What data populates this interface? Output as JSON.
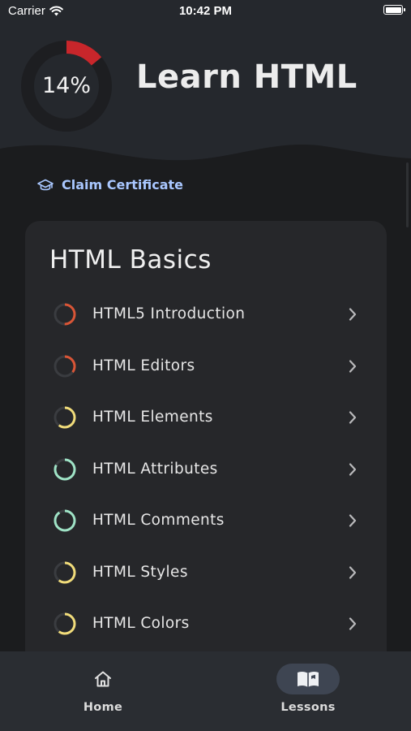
{
  "status_bar": {
    "carrier": "Carrier",
    "time": "10:42 PM"
  },
  "header": {
    "progress_text": "14%",
    "progress_value": 0.14,
    "title": "Learn HTML",
    "colors": {
      "background": "#25282d",
      "ring_track": "#1d1e21",
      "ring_progress": "#c8262b"
    }
  },
  "claim_certificate": {
    "icon": "graduation-cap-icon",
    "label": "Claim Certificate"
  },
  "section": {
    "title": "HTML Basics",
    "lessons": [
      {
        "label": "HTML5 Introduction",
        "progress": 0.5,
        "color": "#d95536",
        "icon": "chevron-right-icon"
      },
      {
        "label": "HTML Editors",
        "progress": 0.35,
        "color": "#d95536",
        "icon": "chevron-right-icon"
      },
      {
        "label": "HTML Elements",
        "progress": 0.6,
        "color": "#f1dc7a",
        "icon": "chevron-right-icon"
      },
      {
        "label": "HTML Attributes",
        "progress": 0.82,
        "color": "#9fe3c6",
        "icon": "chevron-right-icon"
      },
      {
        "label": "HTML Comments",
        "progress": 0.9,
        "color": "#9fe3c6",
        "icon": "chevron-right-icon"
      },
      {
        "label": "HTML Styles",
        "progress": 0.6,
        "color": "#f1dc7a",
        "icon": "chevron-right-icon"
      },
      {
        "label": "HTML Colors",
        "progress": 0.6,
        "color": "#f1dc7a",
        "icon": "chevron-right-icon"
      }
    ]
  },
  "tab_bar": {
    "tabs": [
      {
        "label": "Home",
        "icon": "home-icon",
        "active": false
      },
      {
        "label": "Lessons",
        "icon": "open-book-icon",
        "active": true
      }
    ]
  }
}
